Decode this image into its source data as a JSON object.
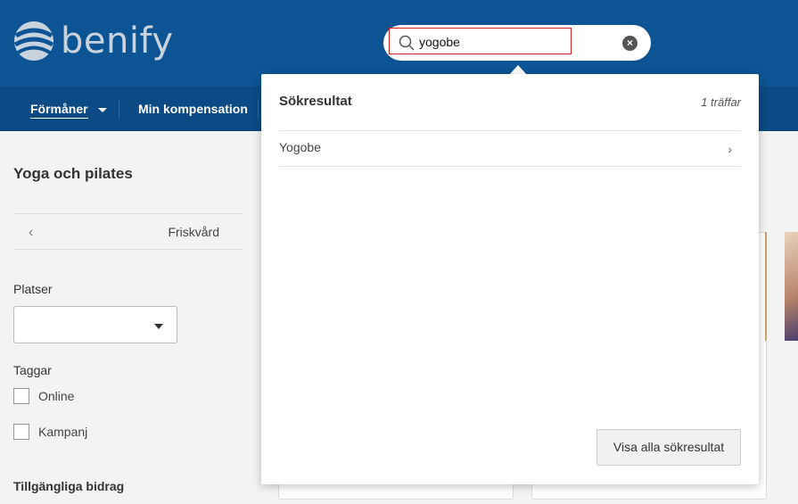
{
  "header": {
    "logo_text": "benify",
    "brand_color": "#0c5494"
  },
  "search": {
    "value": "yogobe",
    "icon": "search-icon",
    "clear_icon": "close-icon",
    "clear_glyph": "×"
  },
  "nav": {
    "items": [
      {
        "label": "Förmåner",
        "has_dropdown": true
      },
      {
        "label": "Min kompensation"
      }
    ]
  },
  "sidebar": {
    "title": "Yoga och pilates",
    "breadcrumb": {
      "back_glyph": "‹",
      "label": "Friskvård"
    },
    "platser_label": "Platser",
    "platser_value": "",
    "taggar_label": "Taggar",
    "tags": [
      {
        "label": "Online",
        "checked": false
      },
      {
        "label": "Kampanj",
        "checked": false
      }
    ],
    "bidrag_label": "Tillgängliga bidrag"
  },
  "search_results": {
    "title": "Sökresultat",
    "count": "1 träffar",
    "results": [
      {
        "label": "Yogobe",
        "chevron": "›"
      }
    ],
    "show_all_label": "Visa alla sökresultat"
  }
}
